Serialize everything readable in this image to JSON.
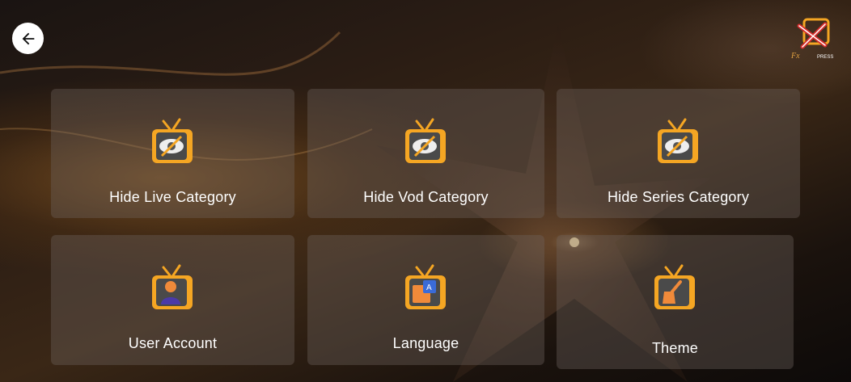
{
  "brand": {
    "logo_text": "FXPRESS"
  },
  "tiles": [
    {
      "label": "Hide Live Category",
      "icon": "hidden-eye-tv-icon"
    },
    {
      "label": "Hide Vod Category",
      "icon": "hidden-eye-tv-icon"
    },
    {
      "label": "Hide Series Category",
      "icon": "hidden-eye-tv-icon"
    },
    {
      "label": "User Account",
      "icon": "user-tv-icon"
    },
    {
      "label": "Language",
      "icon": "translate-tv-icon"
    },
    {
      "label": "Theme",
      "icon": "brush-tv-icon"
    }
  ],
  "colors": {
    "accent": "#f5a623",
    "tile_bg": "#6e645f",
    "text": "#ffffff"
  }
}
